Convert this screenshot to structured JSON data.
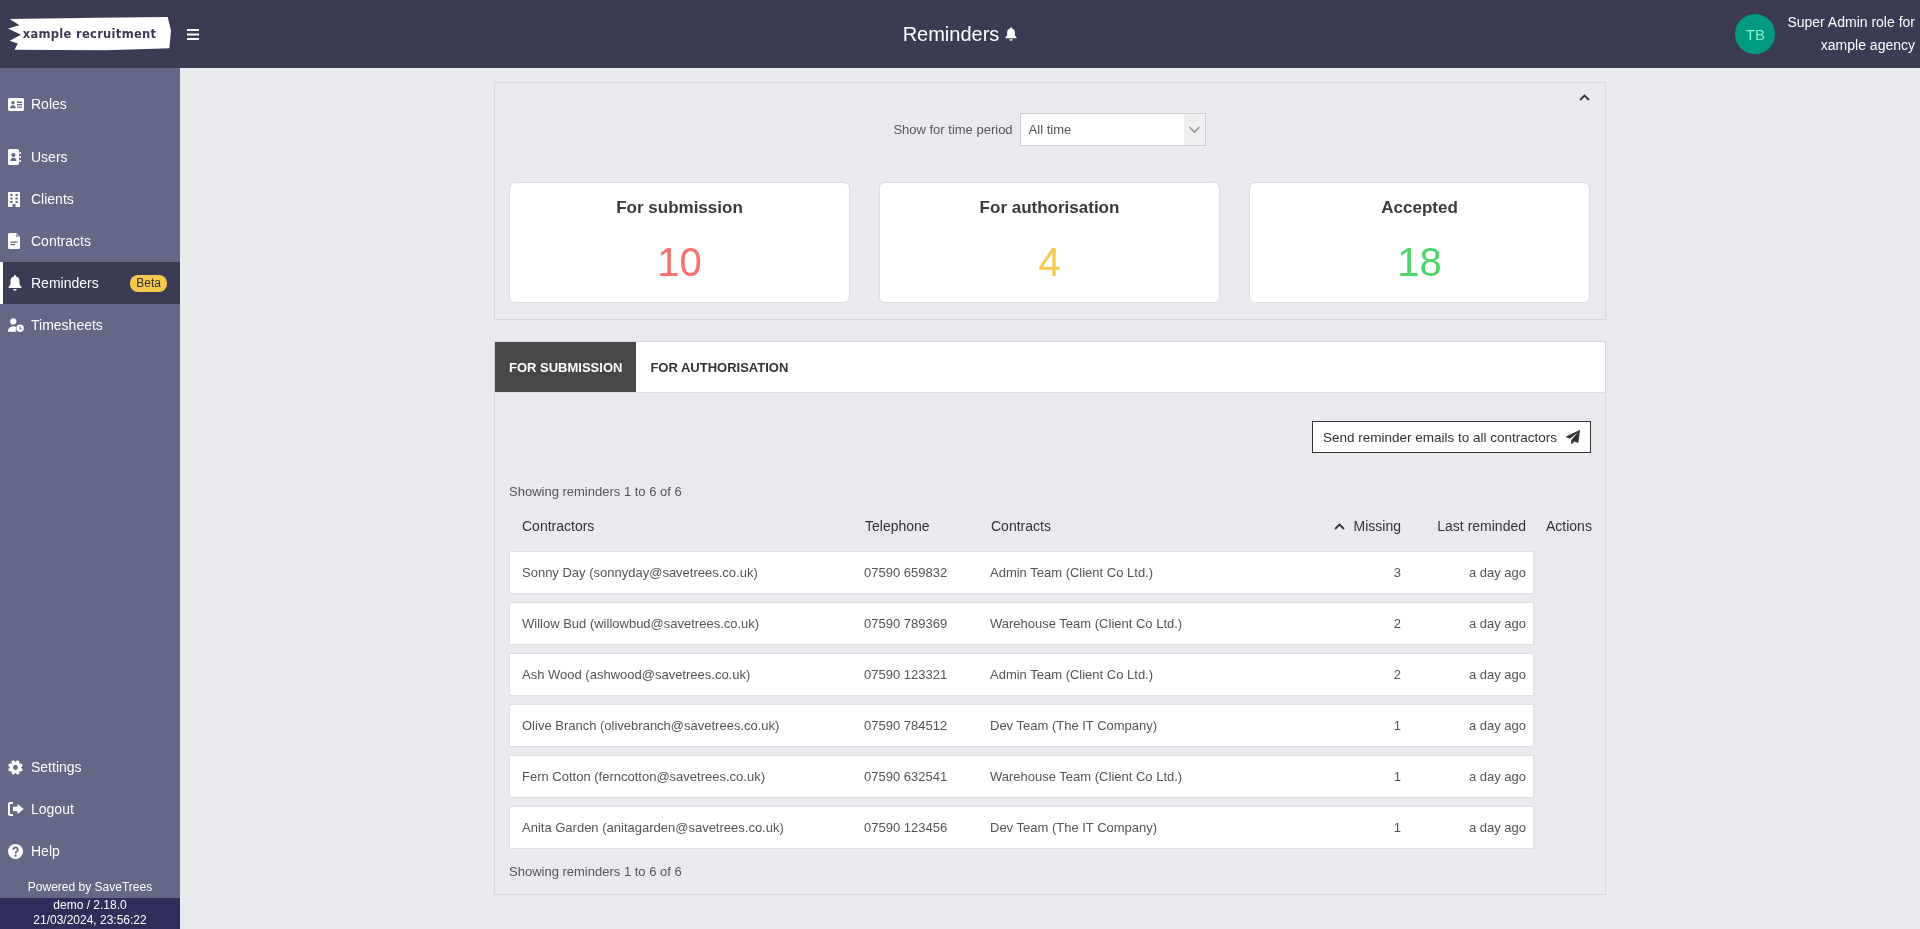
{
  "header": {
    "logo": "xample recruitment",
    "title": "Reminders",
    "user": {
      "initials": "TB",
      "role": "Super Admin role for",
      "agency": "xample agency"
    }
  },
  "sidebar": {
    "items": [
      {
        "label": "Roles",
        "selected": false
      },
      {
        "label": "Users",
        "selected": false
      },
      {
        "label": "Clients",
        "selected": false
      },
      {
        "label": "Contracts",
        "selected": false
      },
      {
        "label": "Reminders",
        "selected": true,
        "badge": "Beta"
      },
      {
        "label": "Timesheets",
        "selected": false
      }
    ],
    "bottom_items": [
      {
        "label": "Settings",
        "selected": false
      },
      {
        "label": "Logout",
        "selected": false
      },
      {
        "label": "Help",
        "selected": false
      }
    ],
    "powered_by": "Powered by SaveTrees",
    "version": "demo / 2.18.0",
    "timestamp": "21/03/2024, 23:56:22"
  },
  "filter_panel": {
    "expanded": true,
    "label": "Show for time period",
    "select": {
      "value": "All time"
    },
    "cards": [
      {
        "title": "For submission",
        "value": "10",
        "color": "#f8716e"
      },
      {
        "title": "For authorisation",
        "value": "4",
        "color": "#f8c84f"
      },
      {
        "title": "Accepted",
        "value": "18",
        "color": "#4cd66a"
      }
    ]
  },
  "reminders_panel": {
    "tabs": [
      {
        "label": "FOR SUBMISSION",
        "selected": true
      },
      {
        "label": "FOR AUTHORISATION",
        "selected": false
      }
    ],
    "send_button": "Send reminder emails to all contractors",
    "summary_top": "Showing reminders 1 to 6 of 6",
    "table": {
      "columns": [
        {
          "label": "Contractors",
          "sorted": false
        },
        {
          "label": "Telephone",
          "sorted": false
        },
        {
          "label": "Contracts",
          "sorted": false
        },
        {
          "label": "Missing",
          "sorted": true
        },
        {
          "label": "Last reminded",
          "sorted": false
        },
        {
          "label": "Actions",
          "sorted": false
        }
      ],
      "rows": [
        {
          "contractor": "Sonny Day (sonnyday@savetrees.co.uk)",
          "telephone": "07590 659832",
          "contract": "Admin Team (Client Co Ltd.)",
          "missing": "3",
          "last_reminded": "a day ago"
        },
        {
          "contractor": "Willow Bud (willowbud@savetrees.co.uk)",
          "telephone": "07590 789369",
          "contract": "Warehouse Team (Client Co Ltd.)",
          "missing": "2",
          "last_reminded": "a day ago"
        },
        {
          "contractor": "Ash Wood (ashwood@savetrees.co.uk)",
          "telephone": "07590 123321",
          "contract": "Admin Team (Client Co Ltd.)",
          "missing": "2",
          "last_reminded": "a day ago"
        },
        {
          "contractor": "Olive Branch (olivebranch@savetrees.co.uk)",
          "telephone": "07590 784512",
          "contract": "Dev Team (The IT Company)",
          "missing": "1",
          "last_reminded": "a day ago"
        },
        {
          "contractor": "Fern Cotton (ferncotton@savetrees.co.uk)",
          "telephone": "07590 632541",
          "contract": "Warehouse Team (Client Co Ltd.)",
          "missing": "1",
          "last_reminded": "a day ago"
        },
        {
          "contractor": "Anita Garden (anitagarden@savetrees.co.uk)",
          "telephone": "07590 123456",
          "contract": "Dev Team (The IT Company)",
          "missing": "1",
          "last_reminded": "a day ago"
        }
      ]
    },
    "summary_bottom": "Showing reminders 1 to 6 of 6"
  }
}
